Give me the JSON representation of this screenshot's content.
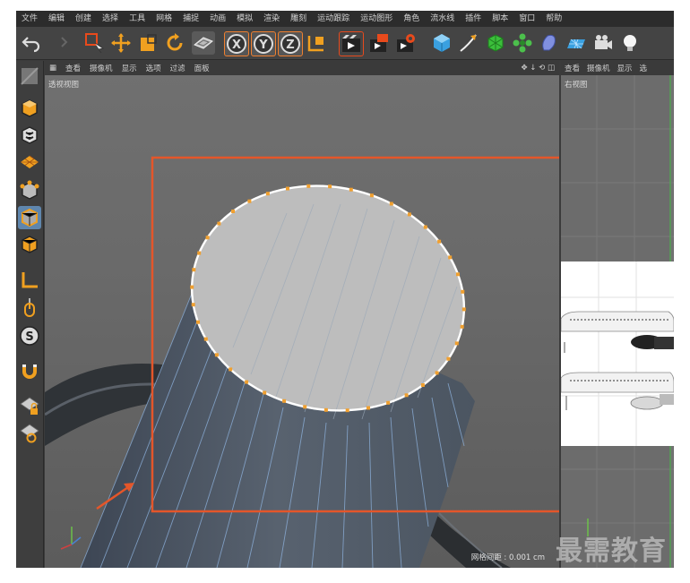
{
  "menu": [
    "文件",
    "编辑",
    "创建",
    "选择",
    "工具",
    "网格",
    "捕捉",
    "动画",
    "模拟",
    "渲染",
    "雕刻",
    "运动跟踪",
    "运动图形",
    "角色",
    "流水线",
    "插件",
    "脚本",
    "窗口",
    "帮助"
  ],
  "viewport": {
    "menu": [
      "查看",
      "摄像机",
      "显示",
      "选项",
      "过滤",
      "面板"
    ],
    "label": "透视视图",
    "grid_spacing": "网格间距 : 0.001 cm"
  },
  "right_view": {
    "menu": [
      "查看",
      "摄像机",
      "显示",
      "选"
    ],
    "label": "右视图"
  },
  "toolbar_icons": [
    "undo-icon",
    "redo-icon",
    "live-selection-icon",
    "move-icon",
    "scale-icon",
    "rotate-icon",
    "last-tool-icon",
    "x-axis-icon",
    "y-axis-icon",
    "z-axis-icon",
    "coordinate-system-icon",
    "render-view-icon",
    "render-picture-viewer-icon",
    "render-settings-icon",
    "cube-icon",
    "pen-spline-icon",
    "subdivision-icon",
    "array-icon",
    "deformer-icon",
    "floor-icon",
    "camera-icon",
    "light-icon"
  ],
  "palette_icons": [
    "make-editable-icon",
    "model-mode-icon",
    "texture-mode-icon",
    "workplane-icon",
    "points-mode-icon",
    "edges-mode-icon",
    "polygons-mode-icon",
    "axis-mode-icon",
    "tweak-icon",
    "snap-icon",
    "magnet-icon",
    "lock-workplane-icon",
    "grid-icon"
  ],
  "colors": {
    "accent": "#e84a1c",
    "highlight_frame": "#e4562a",
    "selected_edge": "#ffffff",
    "point": "#f0a030",
    "wire": "#8fb4e0"
  },
  "watermark": "最需教育"
}
